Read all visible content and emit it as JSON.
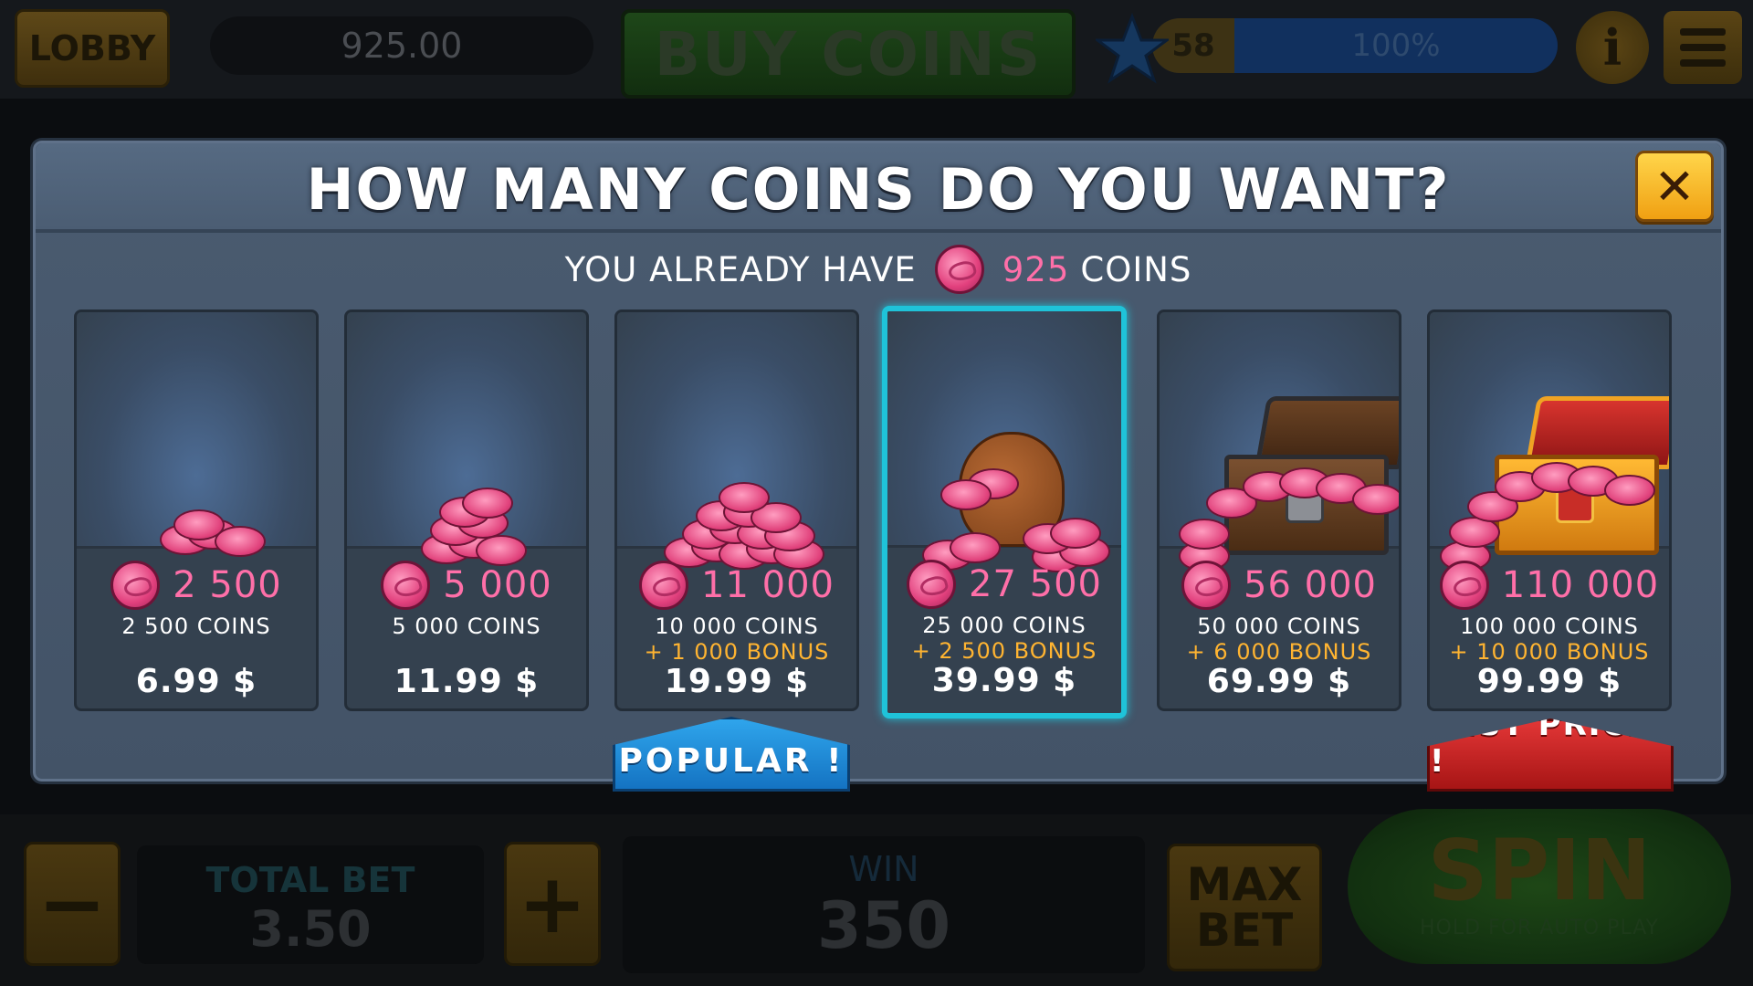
{
  "top_bar": {
    "lobby_label": "LOBBY",
    "balance": "925.00",
    "buy_coins_label": "BUY COINS",
    "level": "58",
    "level_progress": "100%",
    "level_progress_fraction": 1.0,
    "info_label": "i"
  },
  "bottom_bar": {
    "minus_label": "−",
    "plus_label": "+",
    "total_bet_label": "TOTAL BET",
    "total_bet_value": "3.50",
    "win_label": "WIN",
    "win_value": "350",
    "max_label": "MAX",
    "bet_label": "BET",
    "spin_label": "SPIN",
    "spin_sub": "HOLD FOR AUTO PLAY"
  },
  "modal": {
    "title": "HOW MANY COINS DO YOU WANT?",
    "already_prefix": "YOU ALREADY HAVE",
    "already_amount": "925",
    "already_suffix": "COINS",
    "close_label": "✕",
    "selected_index": 3,
    "offers": [
      {
        "amount": "2 500",
        "coins": "2 500 COINS",
        "bonus": "",
        "price": "6.99 $",
        "art": "small-coin-pile"
      },
      {
        "amount": "5 000",
        "coins": "5 000 COINS",
        "bonus": "",
        "price": "11.99 $",
        "art": "coin-stack"
      },
      {
        "amount": "11 000",
        "coins": "10 000 COINS",
        "bonus": "+ 1 000 BONUS",
        "price": "19.99 $",
        "art": "coin-heap"
      },
      {
        "amount": "27 500",
        "coins": "25 000 COINS",
        "bonus": "+ 2 500 BONUS",
        "price": "39.99 $",
        "art": "coin-bag"
      },
      {
        "amount": "56 000",
        "coins": "50 000 COINS",
        "bonus": "+ 6 000 BONUS",
        "price": "69.99 $",
        "art": "wooden-chest"
      },
      {
        "amount": "110 000",
        "coins": "100 000 COINS",
        "bonus": "+ 10 000 BONUS",
        "price": "99.99 $",
        "art": "golden-chest"
      }
    ],
    "popular_label": "POPULAR !",
    "best_price_label": "BEST PRICE !"
  },
  "colors": {
    "accent_pink": "#ff6fa8",
    "bonus_orange": "#ffb431",
    "selected_border": "#1fc3d9",
    "popular_blue": "#1f8fdc",
    "best_red": "#c92222"
  }
}
